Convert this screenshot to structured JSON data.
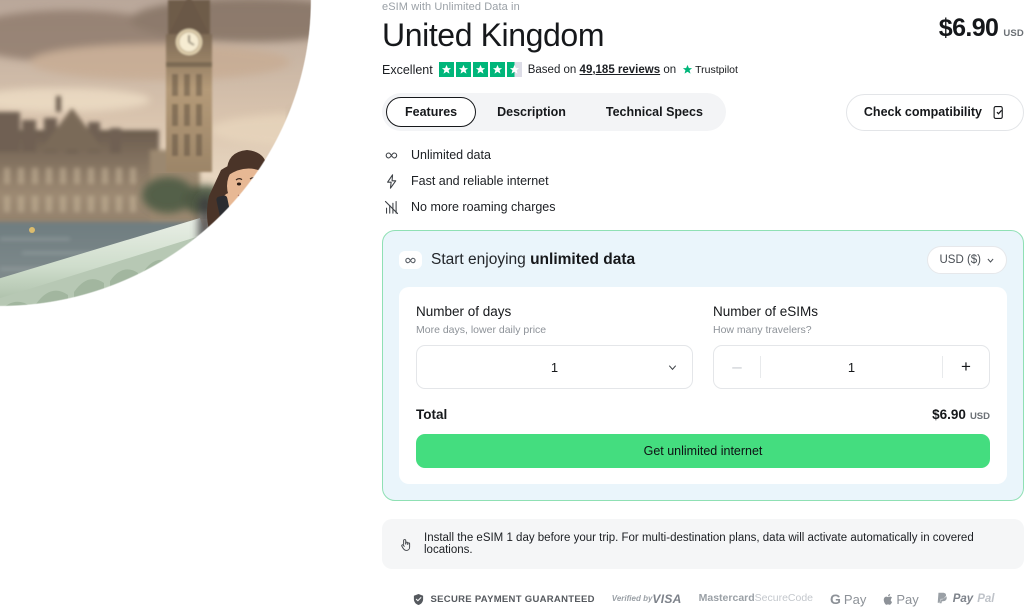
{
  "hero": {
    "alt": "woman-on-westminster-bridge-photo",
    "scene": "Woman in green sweater talking on phone on Westminster Bridge with Big Ben at sunset"
  },
  "header": {
    "eyebrow": "eSIM with Unlimited Data in",
    "title": "United Kingdom",
    "price": "$6.90",
    "price_currency": "USD"
  },
  "rating": {
    "word": "Excellent",
    "stars_filled": 4,
    "has_half_star": true,
    "based_on": "Based on",
    "reviews": "49,185 reviews",
    "on": "on",
    "provider": "Trustpilot",
    "star_color": "#00b67a"
  },
  "tabs": [
    {
      "label": "Features",
      "active": true
    },
    {
      "label": "Description",
      "active": false
    },
    {
      "label": "Technical Specs",
      "active": false
    }
  ],
  "compatibility": {
    "label": "Check compatibility",
    "icon": "phone-check-icon"
  },
  "features": [
    {
      "icon": "infinity-icon",
      "label": "Unlimited data"
    },
    {
      "icon": "lightning-bolt-icon",
      "label": "Fast and reliable internet"
    },
    {
      "icon": "no-roaming-icon",
      "label": "No more roaming charges"
    }
  ],
  "buycard": {
    "icon": "infinity-icon",
    "title_prefix": "Start enjoying ",
    "title_bold": "unlimited data",
    "currency_selected": "USD ($)",
    "accent_border": "#8fe0b4",
    "background": "#eaf5fb",
    "days": {
      "label": "Number of days",
      "hint": "More days, lower daily price",
      "value": "1"
    },
    "esims": {
      "label": "Number of eSIMs",
      "hint": "How many travelers?",
      "value": "1",
      "decrement": "–",
      "increment": "+",
      "decrement_disabled": true
    },
    "total": {
      "label": "Total",
      "price": "$6.90",
      "currency": "USD"
    },
    "cta": {
      "label": "Get unlimited internet",
      "color": "#44dd7f"
    }
  },
  "notice": {
    "icon": "hand-tap-icon",
    "text": "Install the eSIM 1 day before your trip. For multi-destination plans, data will activate automatically in covered locations."
  },
  "payments": {
    "secure_label": "SECURE PAYMENT GUARANTEED",
    "secure_icon": "shield-check-icon",
    "methods": [
      {
        "name": "visa",
        "line1": "Verified by",
        "line2": "VISA"
      },
      {
        "name": "mastercard",
        "line1": "Mastercard",
        "line2": "SecureCode"
      },
      {
        "name": "google-pay",
        "line1": "G",
        "line2": "Pay"
      },
      {
        "name": "apple-pay",
        "line1": "",
        "line2": "Pay"
      },
      {
        "name": "paypal",
        "line1": "Pay",
        "line2": "Pal"
      }
    ]
  }
}
